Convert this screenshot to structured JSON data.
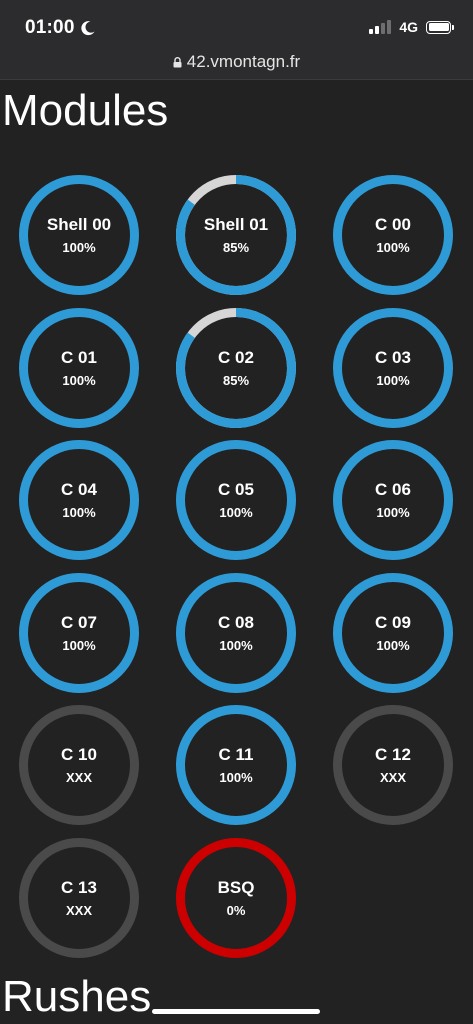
{
  "status_bar": {
    "time": "01:00",
    "focus_icon": "moon-icon",
    "signal_icon": "signal-bars-icon",
    "network": "4G",
    "battery_icon": "battery-icon"
  },
  "browser": {
    "lock_icon": "lock-icon",
    "url": "42.vmontagn.fr"
  },
  "colors": {
    "complete": "#2e9bd6",
    "track": "#d6d6d6",
    "locked": "#4a4a4a",
    "failed": "#cc0000",
    "background": "#222222"
  },
  "sections": {
    "modules_title": "Modules",
    "rushes_title": "Rushes"
  },
  "modules": [
    {
      "name": "Shell 00",
      "percent_text": "100%",
      "progress": 1.0,
      "status": "complete"
    },
    {
      "name": "Shell 01",
      "percent_text": "85%",
      "progress": 0.85,
      "status": "complete"
    },
    {
      "name": "C 00",
      "percent_text": "100%",
      "progress": 1.0,
      "status": "complete"
    },
    {
      "name": "C 01",
      "percent_text": "100%",
      "progress": 1.0,
      "status": "complete"
    },
    {
      "name": "C 02",
      "percent_text": "85%",
      "progress": 0.85,
      "status": "complete"
    },
    {
      "name": "C 03",
      "percent_text": "100%",
      "progress": 1.0,
      "status": "complete"
    },
    {
      "name": "C 04",
      "percent_text": "100%",
      "progress": 1.0,
      "status": "complete"
    },
    {
      "name": "C 05",
      "percent_text": "100%",
      "progress": 1.0,
      "status": "complete"
    },
    {
      "name": "C 06",
      "percent_text": "100%",
      "progress": 1.0,
      "status": "complete"
    },
    {
      "name": "C 07",
      "percent_text": "100%",
      "progress": 1.0,
      "status": "complete"
    },
    {
      "name": "C 08",
      "percent_text": "100%",
      "progress": 1.0,
      "status": "complete"
    },
    {
      "name": "C 09",
      "percent_text": "100%",
      "progress": 1.0,
      "status": "complete"
    },
    {
      "name": "C 10",
      "percent_text": "XXX",
      "progress": 1.0,
      "status": "locked"
    },
    {
      "name": "C 11",
      "percent_text": "100%",
      "progress": 1.0,
      "status": "complete"
    },
    {
      "name": "C 12",
      "percent_text": "XXX",
      "progress": 1.0,
      "status": "locked"
    },
    {
      "name": "C 13",
      "percent_text": "XXX",
      "progress": 1.0,
      "status": "locked"
    },
    {
      "name": "BSQ",
      "percent_text": "0%",
      "progress": 1.0,
      "status": "failed"
    }
  ]
}
